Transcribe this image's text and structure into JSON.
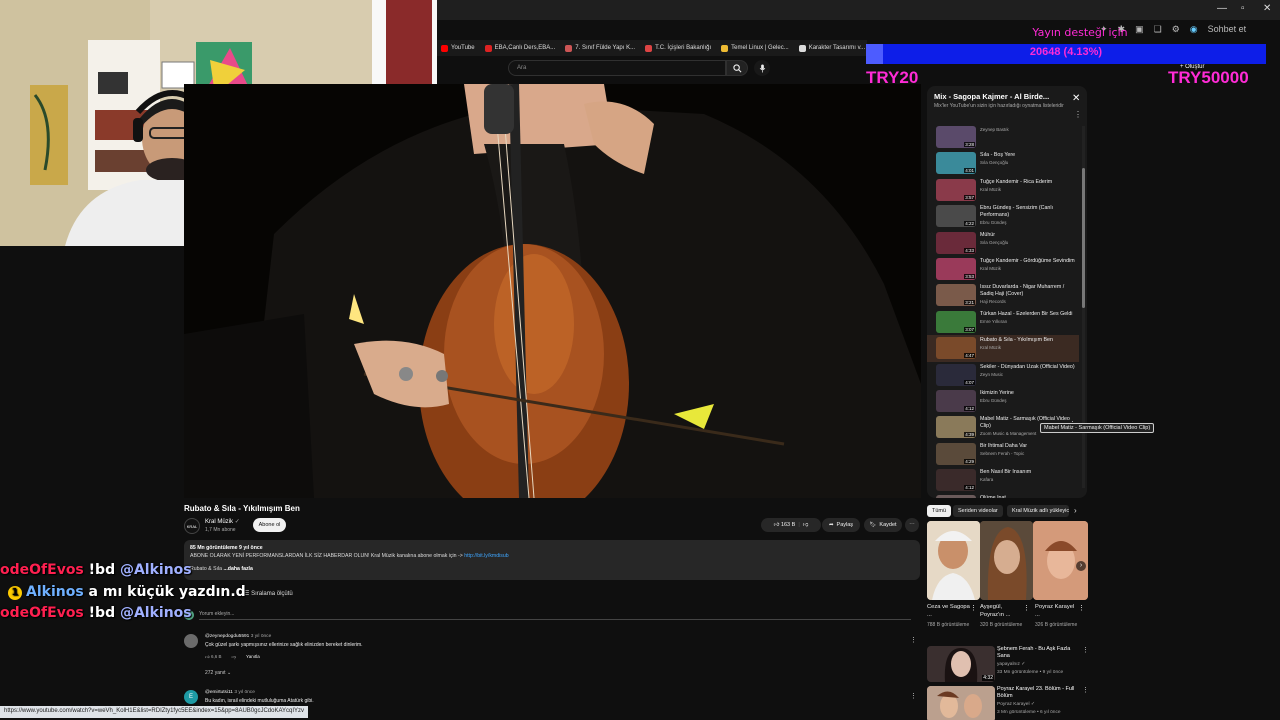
{
  "browser": {
    "bookmarks": [
      "YouTube",
      "EBA,Canlı Ders,EBA...",
      "7. Sınıf Fülde Yapı K...",
      "T.C. İçişleri Bakanlığı",
      "Temel Linux | Gelec...",
      "Karakter Tasarımı v..."
    ],
    "profile_label": "Sohbet et",
    "status_url": "https://www.youtube.com/watch?v=weVh_KolH1E&list=RDIZty1fyc5EE&index=15&pp=8AUB0gcJCdoKAYcqIYzv"
  },
  "youtube": {
    "search_placeholder": "Ara",
    "create_label": "Oluştur"
  },
  "donation": {
    "label": "Yayın desteği için",
    "amount": "20648 (4.13%)",
    "progress_percent": 4.13,
    "min": "TRY20",
    "max": "TRY50000"
  },
  "video": {
    "title": "Rubato & Sıla - Yıkılmışım Ben",
    "channel": "Kral Müzik",
    "subscribers": "1,7 Mn abone",
    "subscribe_label": "Abone ol",
    "likes": "163 B",
    "share_label": "Paylaş",
    "save_label": "Kaydet",
    "description": {
      "stats": "85 Mn görüntüleme  9 yıl önce",
      "line1": "ABONE OLARAK YENİ PERFORMANSLARDAN İLK SİZ HABERDAR OLUN! Kral Müzik kanalına abone olmak için ->",
      "link": "http://bit.ly/kmdisub",
      "line2": "Rubato & Sıla",
      "more": "...daha fazla"
    }
  },
  "comments": {
    "sort_label": "Sıralama ölçütü",
    "placeholder": "Yorum ekleyin...",
    "items": [
      {
        "user": "@zeynepdogdu5591",
        "time": "3 yıl önce",
        "text": "Çok güzel şarkı yapmışsınız ellerinize sağlık elinizden bereket dinlerim.",
        "likes": "6,6 B",
        "reply": "Yanıtla",
        "replies": "272 yanıt"
      },
      {
        "user": "@emirtutsi11",
        "time": "3 yıl önce",
        "text": "Bu kadın, israil elindeki mutluluğuma Atatürk gibi."
      }
    ]
  },
  "chat": [
    {
      "user": "odeOfEvos",
      "cmd": "!bd",
      "mention": "@Alkinos"
    },
    {
      "badge": "1",
      "user": "Alkinos",
      "text": "a mı küçük yazdın.d"
    },
    {
      "user": "odeOfEvos",
      "cmd": "!bd",
      "mention": "@Alkinos"
    }
  ],
  "playlist": {
    "title": "Mix - Sagopa Kajmer - Al Birde...",
    "subtitle": "Mix'ler YouTube'un sizin için hazırladığı oynatma listeleridir",
    "tooltip": "Mabel Matiz - Sarmaşık (Official Video Clip)",
    "items": [
      {
        "title": "",
        "channel": "Zeynep Bastık",
        "duration": "3:28"
      },
      {
        "title": "Sıla - Boş Yere",
        "channel": "Sıla Gençoğlu",
        "duration": "4:01"
      },
      {
        "title": "Tuğçe Kandemir - Rica Ederim",
        "channel": "Kral Müzik",
        "duration": "3:57"
      },
      {
        "title": "Ebru Gündeş - Sensizim (Canlı Performans)",
        "channel": "Ebru Gündeş",
        "duration": "4:22"
      },
      {
        "title": "Mühür",
        "channel": "Sıla Gençoğlu",
        "duration": "4:33"
      },
      {
        "title": "Tuğçe Kandemir - Gördüğüme Sevindim",
        "channel": "Kral Müzik",
        "duration": "3:53"
      },
      {
        "title": "Issız Duvarlarda - Nigar Muharrem / Sadiq Haji (Cover)",
        "channel": "Haji Records",
        "duration": "3:21"
      },
      {
        "title": "Türkan Hazal - Ezelerden Bir Ses Geldi",
        "channel": "Emre Yılkıran",
        "duration": "3:07"
      },
      {
        "title": "Rubato & Sıla - Yıkılmışım Ben",
        "channel": "Kral Müzik",
        "duration": "4:47"
      },
      {
        "title": "Sekiler - Dünyadan Uzak (Official Video)",
        "channel": "Zeyn Music",
        "duration": "4:07"
      },
      {
        "title": "İkimizin Yerine",
        "channel": "Ebru Gündeş",
        "duration": "4:12"
      },
      {
        "title": "Mabel Matiz - Sarmaşık (Official Video Clip)",
        "channel": "Zoom Music & Management",
        "duration": "4:39"
      },
      {
        "title": "Bir İhtimal Daha Var",
        "channel": "Sebnem Ferah - Topic",
        "duration": "4:29"
      },
      {
        "title": "Ben Nasıl Bir İnsanım",
        "channel": "Kafara",
        "duration": "4:12"
      },
      {
        "title": "Ölüme İnat",
        "channel": "",
        "duration": ""
      }
    ]
  },
  "recommendations": {
    "chips": [
      "Tümü",
      "Seriden videolar",
      "Kral Müzik adlı yükleyiciden"
    ],
    "cards": [
      {
        "title": "Ceza ve Sagopa ...",
        "views": "788 B görüntüleme"
      },
      {
        "title": "Ayşegül, Poyraz'ın ...",
        "views": "320 B görüntüleme"
      },
      {
        "title": "Poyraz Karayel ...",
        "views": "326 B görüntüleme"
      }
    ],
    "list": [
      {
        "title": "Şebnem Ferah - Bu Aşk Fazla Sana",
        "channel": "yapayalnız",
        "meta": "33 Mn görüntüleme • 9 yıl önce",
        "duration": "4:32"
      },
      {
        "title": "Poyraz Karayel 23. Bölüm - Full Bölüm",
        "channel": "Poyraz Karayel",
        "meta": "3 Mn görüntüleme • 6 yıl önce",
        "duration": ""
      }
    ]
  }
}
